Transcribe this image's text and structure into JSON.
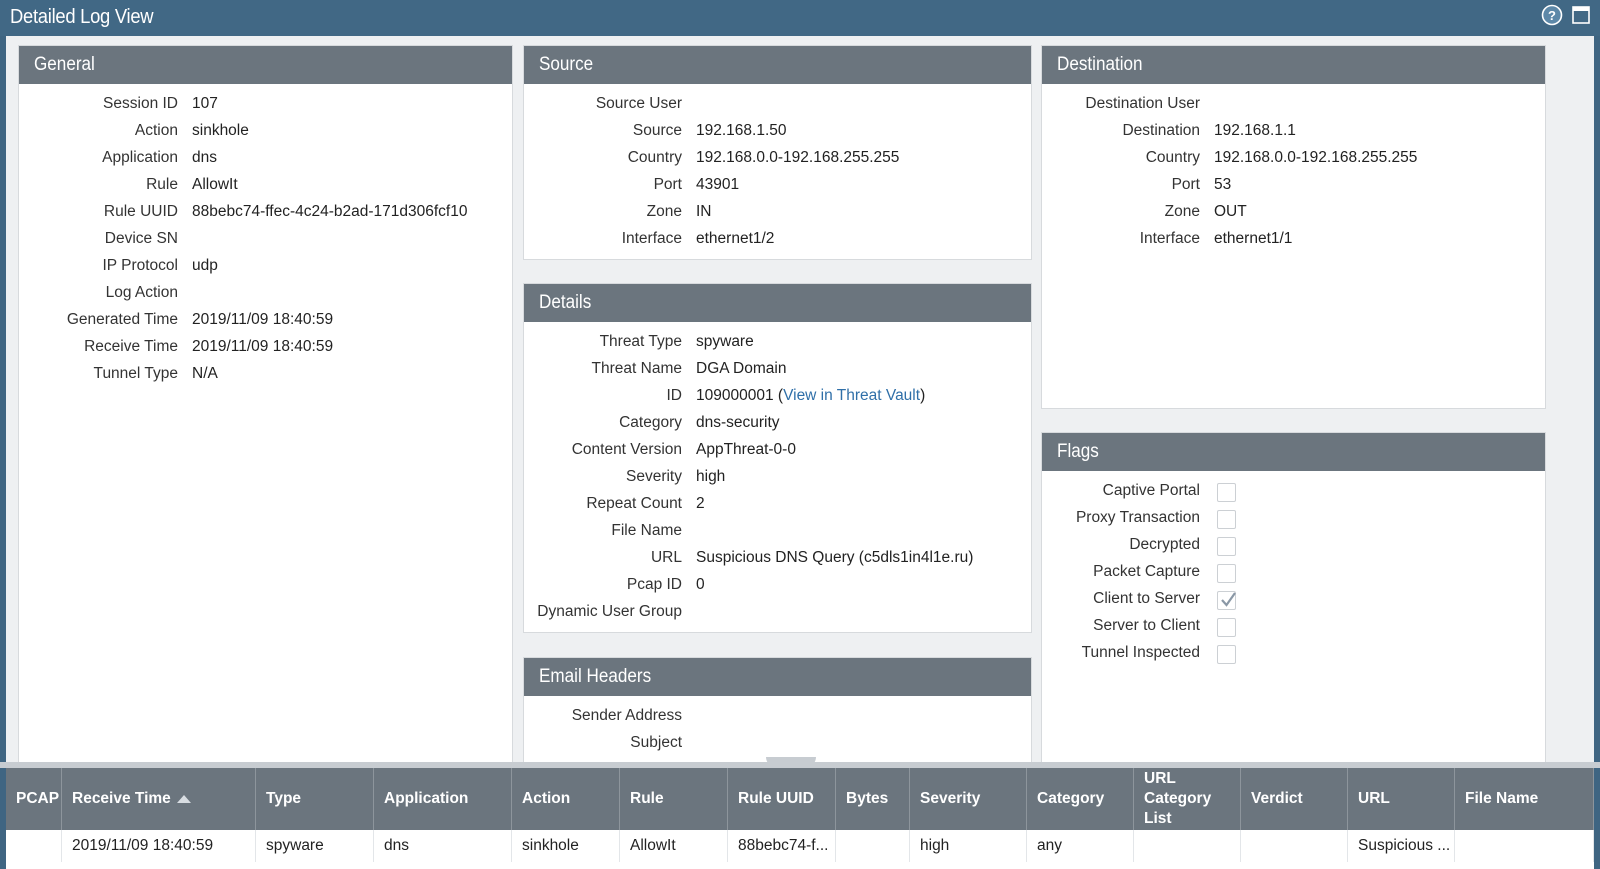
{
  "window": {
    "title": "Detailed Log View",
    "help_icon": "help-icon",
    "maximize_icon": "maximize-icon"
  },
  "general": {
    "header": "General",
    "fields": [
      {
        "label": "Session ID",
        "value": "107"
      },
      {
        "label": "Action",
        "value": "sinkhole"
      },
      {
        "label": "Application",
        "value": "dns"
      },
      {
        "label": "Rule",
        "value": "AllowIt"
      },
      {
        "label": "Rule UUID",
        "value": "88bebc74-ffec-4c24-b2ad-171d306fcf10"
      },
      {
        "label": "Device SN",
        "value": ""
      },
      {
        "label": "IP Protocol",
        "value": "udp"
      },
      {
        "label": "Log Action",
        "value": ""
      },
      {
        "label": "Generated Time",
        "value": "2019/11/09 18:40:59"
      },
      {
        "label": "Receive Time",
        "value": "2019/11/09 18:40:59"
      },
      {
        "label": "Tunnel Type",
        "value": "N/A"
      }
    ]
  },
  "source": {
    "header": "Source",
    "fields": [
      {
        "label": "Source User",
        "value": ""
      },
      {
        "label": "Source",
        "value": "192.168.1.50"
      },
      {
        "label": "Country",
        "value": "192.168.0.0-192.168.255.255"
      },
      {
        "label": "Port",
        "value": "43901"
      },
      {
        "label": "Zone",
        "value": "IN"
      },
      {
        "label": "Interface",
        "value": "ethernet1/2"
      }
    ]
  },
  "destination": {
    "header": "Destination",
    "fields": [
      {
        "label": "Destination User",
        "value": ""
      },
      {
        "label": "Destination",
        "value": "192.168.1.1"
      },
      {
        "label": "Country",
        "value": "192.168.0.0-192.168.255.255"
      },
      {
        "label": "Port",
        "value": "53"
      },
      {
        "label": "Zone",
        "value": "OUT"
      },
      {
        "label": "Interface",
        "value": "ethernet1/1"
      }
    ]
  },
  "details": {
    "header": "Details",
    "fields": [
      {
        "label": "Threat Type",
        "value": "spyware"
      },
      {
        "label": "Threat Name",
        "value": "DGA Domain"
      },
      {
        "label": "ID",
        "value": "109000001 (",
        "link": "View in Threat Vault",
        "suffix": ")"
      },
      {
        "label": "Category",
        "value": "dns-security"
      },
      {
        "label": "Content Version",
        "value": "AppThreat-0-0"
      },
      {
        "label": "Severity",
        "value": "high"
      },
      {
        "label": "Repeat Count",
        "value": "2"
      },
      {
        "label": "File Name",
        "value": ""
      },
      {
        "label": "URL",
        "value": "Suspicious DNS Query (c5dls1in4l1e.ru)"
      },
      {
        "label": "Pcap ID",
        "value": "0"
      },
      {
        "label": "Dynamic User Group",
        "value": ""
      }
    ]
  },
  "email_headers": {
    "header": "Email Headers",
    "fields": [
      {
        "label": "Sender Address",
        "value": ""
      },
      {
        "label": "Subject",
        "value": ""
      }
    ]
  },
  "flags": {
    "header": "Flags",
    "items": [
      {
        "label": "Captive Portal",
        "checked": false
      },
      {
        "label": "Proxy Transaction",
        "checked": false
      },
      {
        "label": "Decrypted",
        "checked": false
      },
      {
        "label": "Packet Capture",
        "checked": false
      },
      {
        "label": "Client to Server",
        "checked": true
      },
      {
        "label": "Server to Client",
        "checked": false
      },
      {
        "label": "Tunnel Inspected",
        "checked": false
      }
    ]
  },
  "grid": {
    "columns": [
      "PCAP",
      "Receive Time",
      "Type",
      "Application",
      "Action",
      "Rule",
      "Rule UUID",
      "Bytes",
      "Severity",
      "Category",
      "URL Category List",
      "Verdict",
      "URL",
      "File Name"
    ],
    "sorted_column": "Receive Time",
    "rows": [
      [
        "",
        "2019/11/09 18:40:59",
        "spyware",
        "dns",
        "sinkhole",
        "AllowIt",
        "88bebc74-f...",
        "",
        "high",
        "any",
        "",
        "",
        "Suspicious ...",
        ""
      ]
    ]
  },
  "colors": {
    "title_bar": "#416885",
    "panel_header": "#6b757e",
    "link": "#2f6fa8"
  }
}
